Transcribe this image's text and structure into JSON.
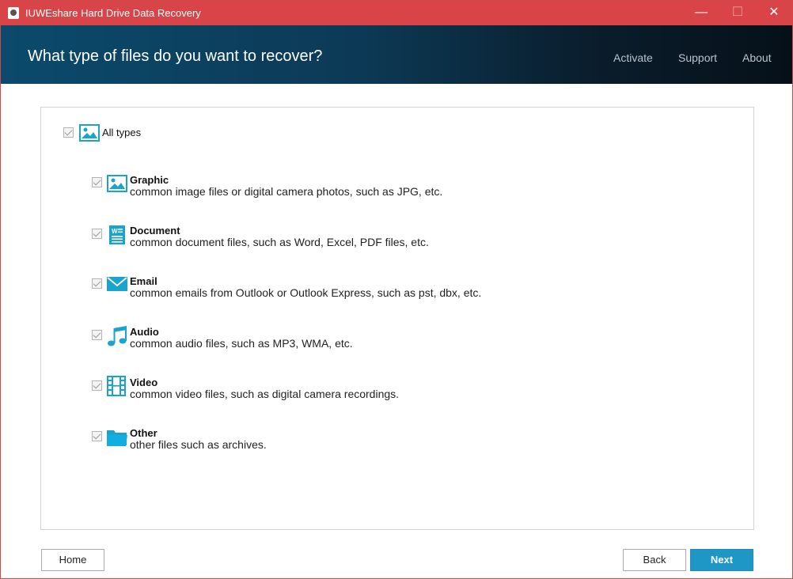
{
  "window": {
    "title": "IUWEshare Hard Drive Data Recovery",
    "controls": {
      "minimize": "—",
      "maximize": "☐",
      "close": "✕"
    }
  },
  "header": {
    "title": "What type of files do you want to recover?",
    "nav": [
      "Activate",
      "Support",
      "About"
    ]
  },
  "all_types": {
    "label": "All types",
    "checked": true,
    "icon": "image-icon"
  },
  "file_types": [
    {
      "title": "Graphic",
      "description": "common image files or digital camera photos, such as JPG, etc.",
      "checked": true,
      "icon": "image-icon"
    },
    {
      "title": "Document",
      "description": "common document files, such as Word, Excel, PDF files, etc.",
      "checked": true,
      "icon": "document-icon"
    },
    {
      "title": "Email",
      "description": "common emails from Outlook or Outlook Express, such as pst, dbx, etc.",
      "checked": true,
      "icon": "email-icon"
    },
    {
      "title": "Audio",
      "description": "common audio files, such as MP3, WMA, etc.",
      "checked": true,
      "icon": "music-note-icon"
    },
    {
      "title": "Video",
      "description": "common video files, such as digital camera recordings.",
      "checked": true,
      "icon": "film-icon"
    },
    {
      "title": "Other",
      "description": "other files such as archives.",
      "checked": true,
      "icon": "folder-icon"
    }
  ],
  "buttons": {
    "home": "Home",
    "back": "Back",
    "next": "Next"
  },
  "colors": {
    "titlebar": "#d84448",
    "accent": "#1e97c6",
    "icon": "#1aa3cc"
  }
}
